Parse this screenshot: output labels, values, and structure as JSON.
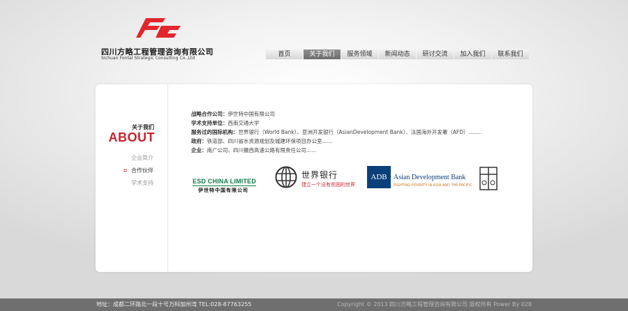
{
  "company": {
    "name_cn": "四川方略工程管理咨询有限公司",
    "name_en": "Sichuan Fontal Strategic Consulting Co.,Ltd",
    "logo_color": "#e1262d"
  },
  "nav": {
    "items": [
      {
        "label": "首页"
      },
      {
        "label": "关于我们"
      },
      {
        "label": "服务领域"
      },
      {
        "label": "新闻动态"
      },
      {
        "label": "研讨交流"
      },
      {
        "label": "加入我们"
      },
      {
        "label": "联系我们"
      }
    ],
    "active": "关于我们"
  },
  "section": {
    "title_cn": "关于我们",
    "title_en": "ABOUT",
    "menu": [
      {
        "label": "企业简介"
      },
      {
        "label": "合作伙伴"
      },
      {
        "label": "学术支持"
      }
    ],
    "active_menu": "合作伙伴"
  },
  "content": {
    "lines": [
      {
        "label": "战略合作公司：",
        "text": "伊世特中国有限公司"
      },
      {
        "label": "学术支持单位：",
        "text": "西南交通大学"
      },
      {
        "label": "服务过的国际机构：",
        "text": "世界银行（World Bank）、亚洲开发银行（AsianDevelopment Bank）、法国海外开发署（AFD）........"
      },
      {
        "label": "政府：",
        "text": "铁道部、四川省水资源规划及城建环保项目办公室......"
      },
      {
        "label": "企业：",
        "text": "南广公司、四川撒西高速公路有限责任公司......"
      }
    ]
  },
  "partners": {
    "esd": {
      "title": "ESD CHINA LIMITED",
      "subtitle": "伊世特中国有限公司"
    },
    "worldbank": {
      "title": "世界银行",
      "subtitle": "建立一个没有贫困的世界"
    },
    "adb": {
      "box": "ADB",
      "title": "Asian Development Bank",
      "subtitle": "FIGHTING POVERTY IN ASIA AND THE PACIFIC"
    }
  },
  "footer": {
    "address": "地址：成都二环路北一段十号万科加州湾 TEL:028-87763255",
    "copyright": "Copyright © 2013 四川方略工程管理咨询有限公司 版权所有 Power By 028"
  }
}
